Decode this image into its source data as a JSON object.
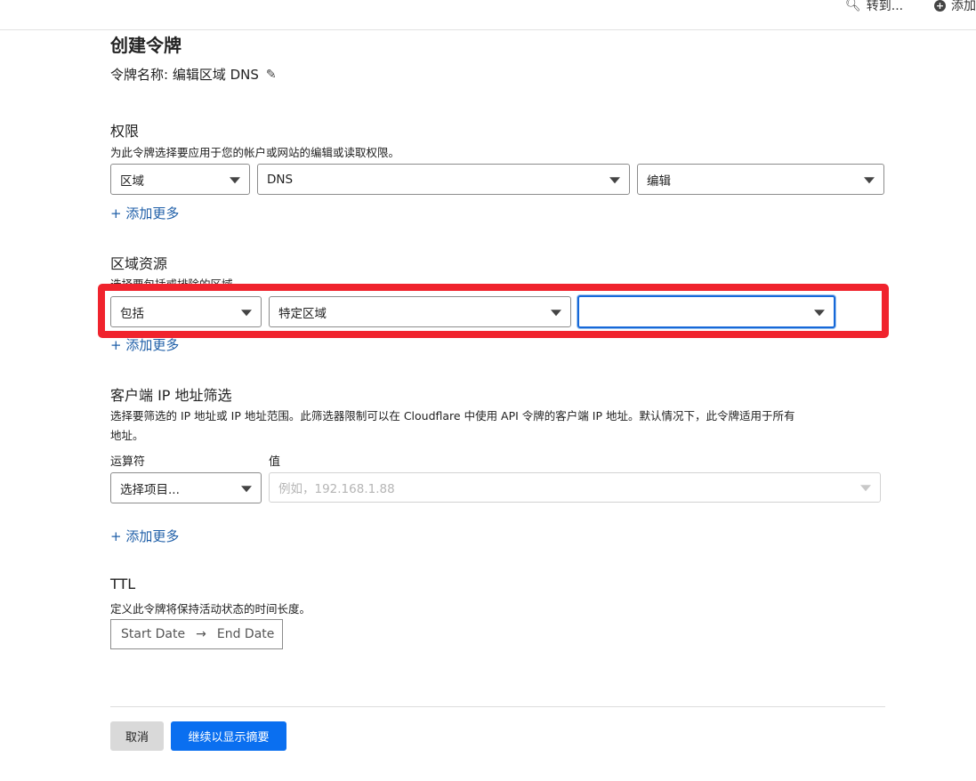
{
  "topbar": {
    "goto_label": "转到...",
    "add_label": "添加"
  },
  "page": {
    "title": "创建令牌",
    "token_name": "令牌名称: 编辑区域 DNS"
  },
  "permissions": {
    "title": "权限",
    "description": "为此令牌选择要应用于您的帐户或网站的编辑或读取权限。",
    "selects": [
      "区域",
      "DNS",
      "编辑"
    ],
    "add_more": "+ 添加更多"
  },
  "zone_resources": {
    "title": "区域资源",
    "description": "选择要包括或排除的区域。",
    "selects": [
      "包括",
      "特定区域",
      ""
    ],
    "add_more": "+ 添加更多"
  },
  "ip_filter": {
    "title": "客户端 IP 地址筛选",
    "description_line1": "选择要筛选的 IP 地址或 IP 地址范围。此筛选器限制可以在 Cloudflare 中使用 API 令牌的客户端 IP 地址。默认情况下，此令牌适用于所有",
    "description_line2": "地址。",
    "operator_label": "运算符",
    "value_label": "值",
    "operator_select": "选择项目...",
    "value_placeholder": "例如，192.168.1.88",
    "add_more": "+ 添加更多"
  },
  "ttl": {
    "title": "TTL",
    "description": "定义此令牌将保持活动状态的时间长度。",
    "start_date": "Start Date",
    "arrow": "→",
    "end_date": "End Date"
  },
  "actions": {
    "cancel": "取消",
    "continue": "继续以显示摘要"
  },
  "colors": {
    "primary": "#0a6ff0",
    "highlight": "#f0232d",
    "link": "#1f5fa8"
  }
}
